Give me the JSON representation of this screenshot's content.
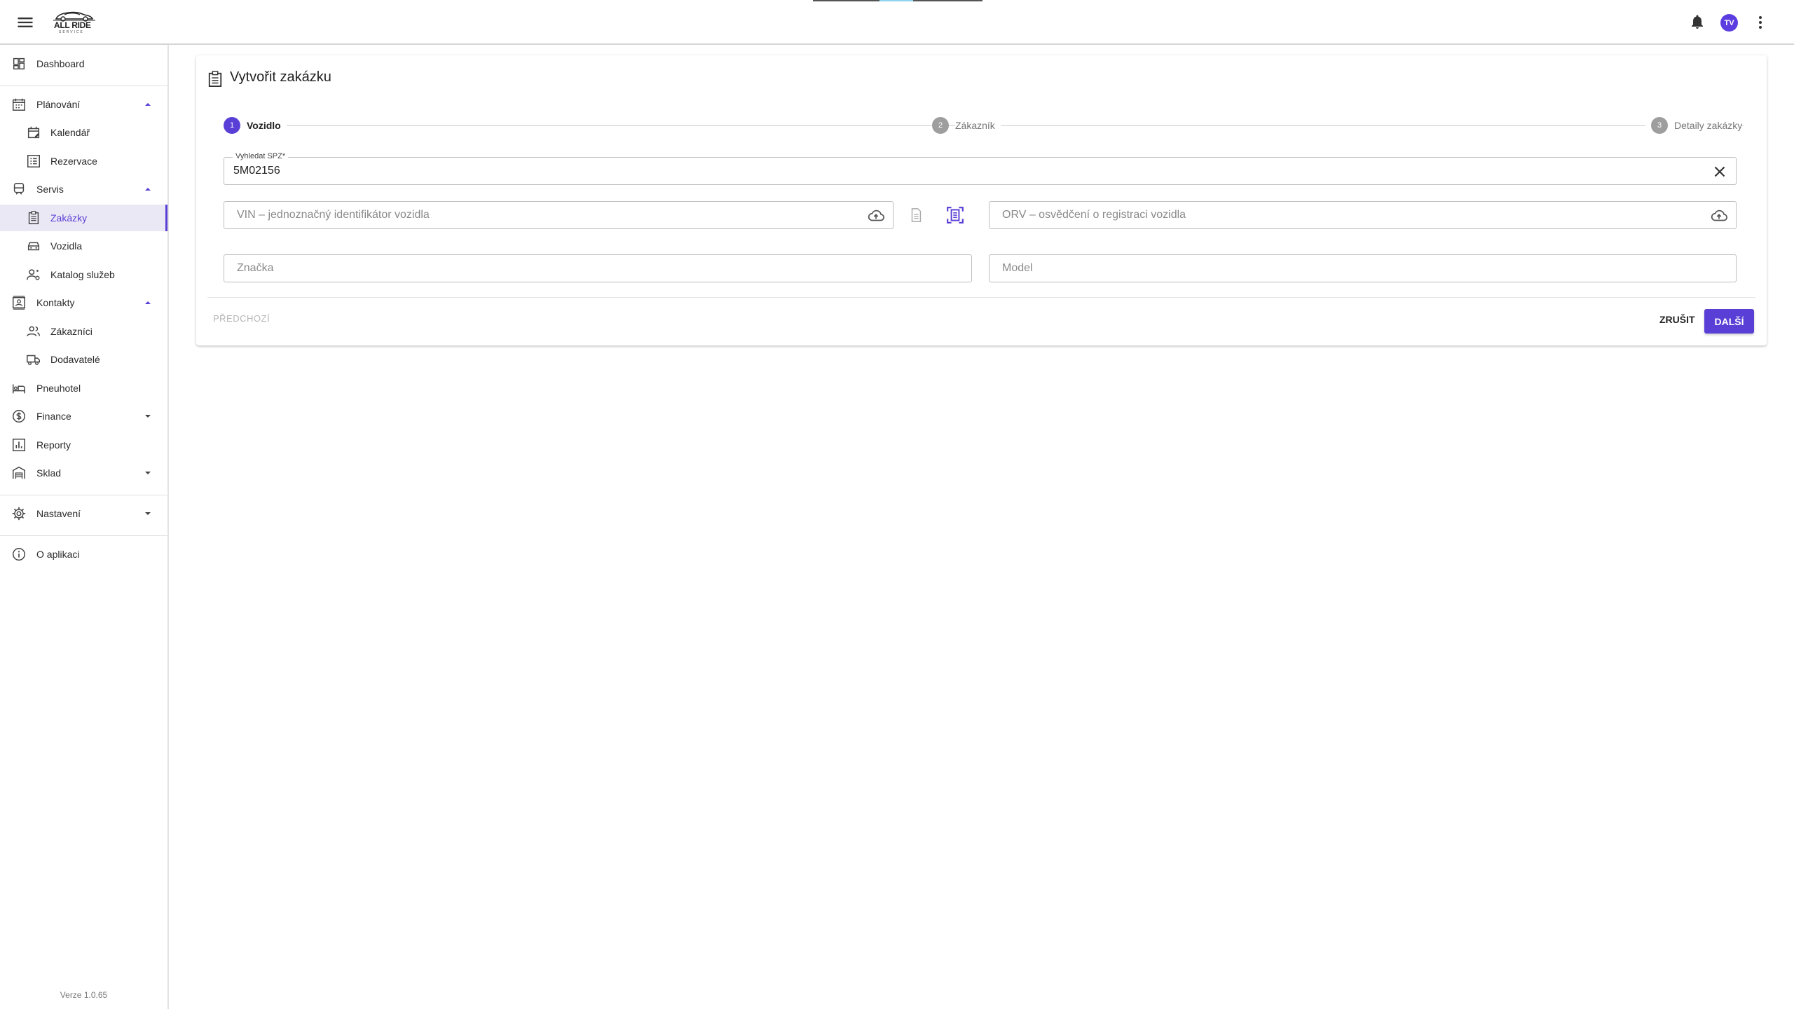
{
  "app": {
    "logo_text": "ALL RIDE",
    "logo_subtext": "SERVICE",
    "user_initials": "TV"
  },
  "sidebar": {
    "items": [
      {
        "label": "Dashboard",
        "icon": "dashboard-icon"
      },
      {
        "label": "Plánování",
        "icon": "calendar-grid-icon",
        "expanded": true
      },
      {
        "label": "Kalendář",
        "icon": "calendar-edit-icon"
      },
      {
        "label": "Rezervace",
        "icon": "list-alt-icon"
      },
      {
        "label": "Servis",
        "icon": "train-icon",
        "expanded": true
      },
      {
        "label": "Zakázky",
        "icon": "clipboard-icon",
        "active": true
      },
      {
        "label": "Vozidla",
        "icon": "car-icon"
      },
      {
        "label": "Katalog služeb",
        "icon": "person-settings-icon"
      },
      {
        "label": "Kontakty",
        "icon": "contacts-icon",
        "expanded": true
      },
      {
        "label": "Zákazníci",
        "icon": "people-icon"
      },
      {
        "label": "Dodavatelé",
        "icon": "truck-icon"
      },
      {
        "label": "Pneuhotel",
        "icon": "hotel-icon"
      },
      {
        "label": "Finance",
        "icon": "dollar-circle-icon",
        "expanded": false
      },
      {
        "label": "Reporty",
        "icon": "bar-chart-icon"
      },
      {
        "label": "Sklad",
        "icon": "warehouse-icon",
        "expanded": false
      },
      {
        "label": "Nastavení",
        "icon": "gear-icon",
        "expanded": false
      },
      {
        "label": "O aplikaci",
        "icon": "info-icon"
      }
    ],
    "version": "Verze 1.0.65"
  },
  "page": {
    "title": "Vytvořit zakázku",
    "steps": [
      {
        "number": "1",
        "label": "Vozidlo",
        "active": true
      },
      {
        "number": "2",
        "label": "Zákazník",
        "active": false
      },
      {
        "number": "3",
        "label": "Detaily zakázky",
        "active": false
      }
    ],
    "form": {
      "spz_label": "Vyhledat SPZ*",
      "spz_value": "5M02156",
      "vin_placeholder": "VIN – jednoznačný identifikátor vozidla",
      "orv_placeholder": "ORV – osvědčení o registraci vozidla",
      "brand_placeholder": "Značka",
      "model_placeholder": "Model"
    },
    "buttons": {
      "prev": "PŘEDCHOZÍ",
      "cancel": "ZRUŠIT",
      "next": "DALŠÍ"
    }
  },
  "colors": {
    "accent": "#5a3fd6",
    "active_bg": "#ebe8f5"
  }
}
